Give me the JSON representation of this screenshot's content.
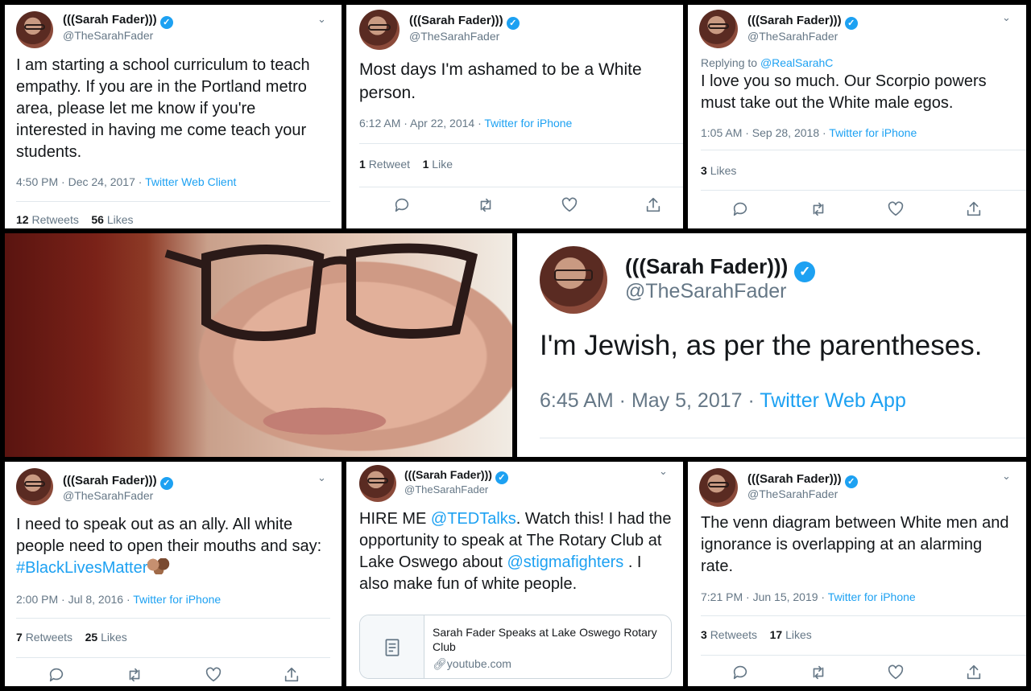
{
  "tweets": {
    "t1": {
      "name": "(((Sarah Fader)))",
      "handle": "@TheSarahFader",
      "text": "I am starting a school curriculum to teach empathy. If you are in the Portland metro area, please let me know if you're interested in having me come teach your students.",
      "time": "4:50 PM · Dec 24, 2017 · ",
      "source": "Twitter Web Client",
      "retweets": "12",
      "retweets_label": "Retweets",
      "likes": "56",
      "likes_label": "Likes"
    },
    "t2": {
      "name": "(((Sarah Fader)))",
      "handle": "@TheSarahFader",
      "text": "Most days I'm ashamed to be a White person.",
      "time": "6:12 AM · Apr 22, 2014 · ",
      "source": "Twitter for iPhone",
      "retweets": "1",
      "retweets_label": "Retweet",
      "likes": "1",
      "likes_label": "Like"
    },
    "t3": {
      "name": "(((Sarah Fader)))",
      "handle": "@TheSarahFader",
      "replying_label": "Replying to ",
      "replying_to": "@RealSarahC",
      "text": "I love you so much. Our Scorpio powers must take out the White male egos.",
      "time": "1:05 AM · Sep 28, 2018 · ",
      "source": "Twitter for iPhone",
      "likes": "3",
      "likes_label": "Likes"
    },
    "t4": {
      "name": "(((Sarah Fader)))",
      "handle": "@TheSarahFader",
      "text": "I'm Jewish, as per the parentheses.",
      "time": "6:45 AM · May 5, 2017 · ",
      "source": "Twitter Web App"
    },
    "t5": {
      "name": "(((Sarah Fader)))",
      "handle": "@TheSarahFader",
      "text": "I need to speak out as an ally. All white people need to open their mouths and say: ",
      "hashtag": "#BlackLivesMatter",
      "time": "2:00 PM · Jul 8, 2016 · ",
      "source": "Twitter for iPhone",
      "retweets": "7",
      "retweets_label": "Retweets",
      "likes": "25",
      "likes_label": "Likes"
    },
    "t6": {
      "name": "(((Sarah Fader)))",
      "handle": "@TheSarahFader",
      "text_a": "HIRE ME ",
      "mention_a": "@TEDTalks",
      "text_b": ". Watch this! I had the opportunity to speak at The Rotary Club at Lake Oswego about ",
      "mention_b": "@stigmafighters",
      "text_c": " . I also make fun of white people.",
      "card_title": "Sarah Fader Speaks at Lake Oswego Rotary Club",
      "card_domain": "youtube.com"
    },
    "t7": {
      "name": "(((Sarah Fader)))",
      "handle": "@TheSarahFader",
      "text": "The venn diagram between White men and ignorance is overlapping at an alarming rate.",
      "time": "7:21 PM · Jun 15, 2019 · ",
      "source": "Twitter for iPhone",
      "retweets": "3",
      "retweets_label": "Retweets",
      "likes": "17",
      "likes_label": "Likes"
    }
  },
  "icons": {
    "verified": "verified-badge-icon",
    "reply": "reply-icon",
    "retweet": "retweet-icon",
    "like": "heart-icon",
    "share": "share-icon",
    "chevron": "chevron-down-icon",
    "card": "document-icon",
    "link": "link-icon"
  },
  "colors": {
    "link": "#1da1f2",
    "secondary": "#657786",
    "text": "#14171a",
    "divider": "#e1e8ed"
  }
}
